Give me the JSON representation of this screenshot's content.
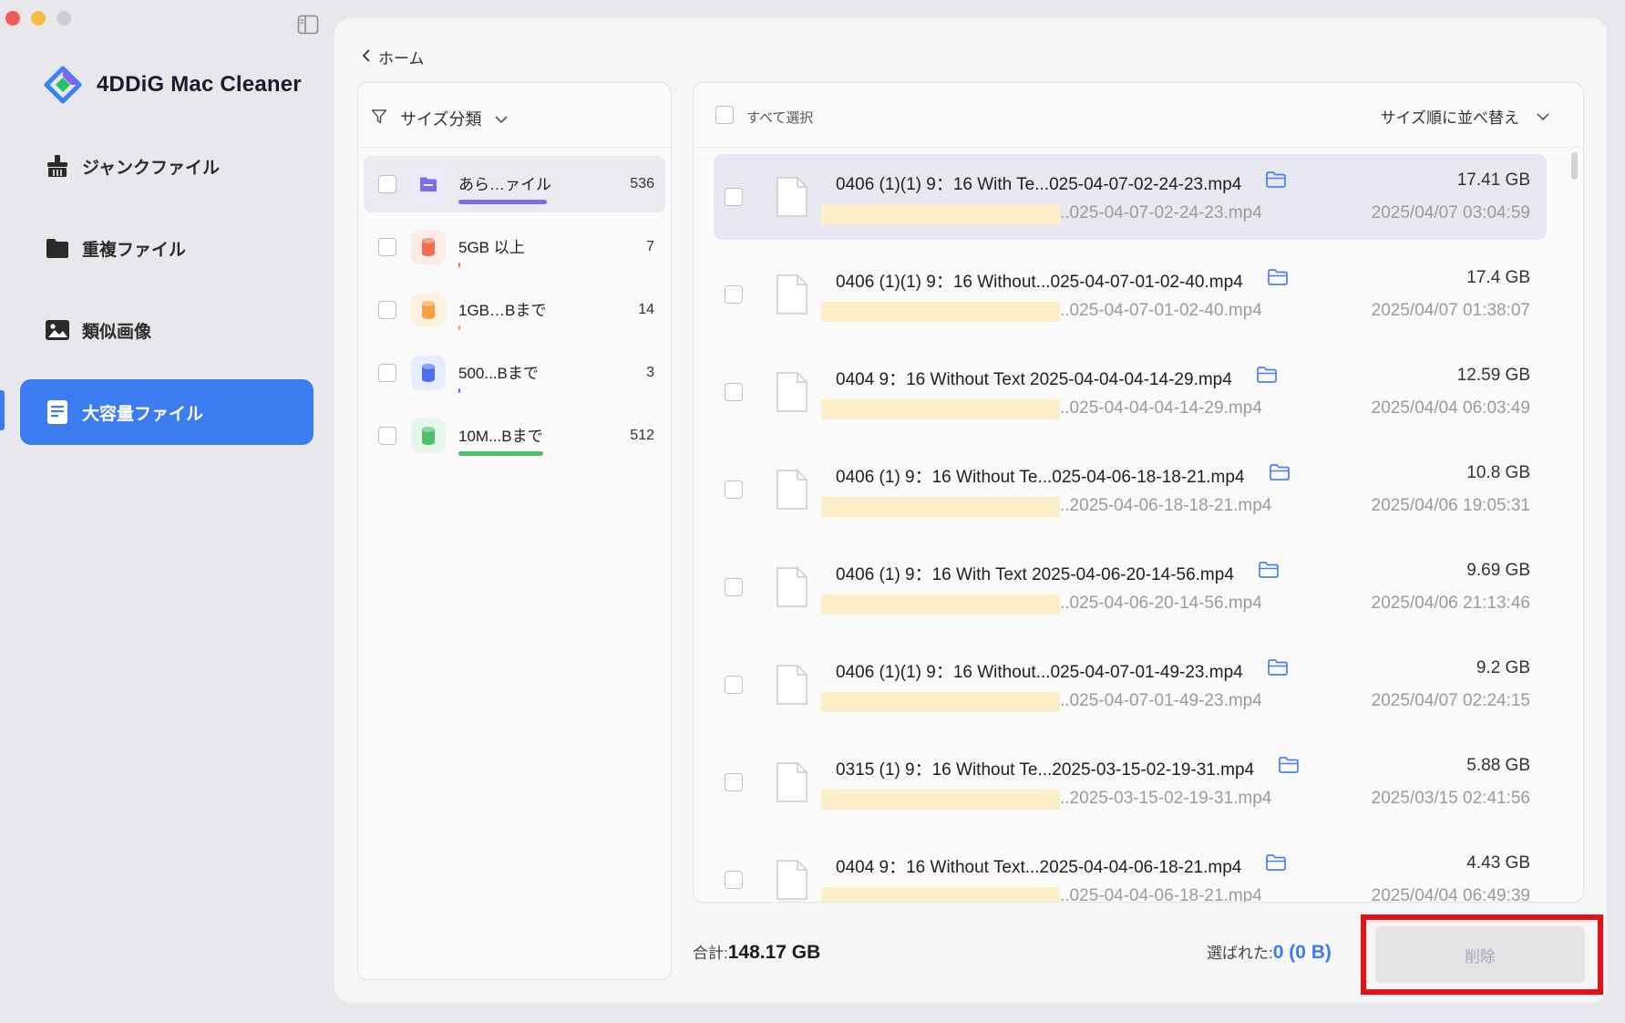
{
  "app": {
    "name": "4DDiG Mac Cleaner"
  },
  "sidebar": {
    "items": [
      {
        "label": "ジャンクファイル",
        "icon": "broom-icon"
      },
      {
        "label": "重複ファイル",
        "icon": "folder-icon"
      },
      {
        "label": "類似画像",
        "icon": "image-icon"
      },
      {
        "label": "大容量ファイル",
        "icon": "large-file-icon",
        "active": true
      }
    ]
  },
  "main": {
    "back_label": "ホーム",
    "category_panel": {
      "header": "サイズ分類",
      "categories": [
        {
          "label": "あら…ァイル",
          "count": "536",
          "color": "#7a6cf0",
          "bar_fraction": 0.97
        },
        {
          "label": "5GB 以上",
          "count": "7",
          "color": "#f06b4f",
          "bar_fraction": 0.01
        },
        {
          "label": "1GB…Bまで",
          "count": "14",
          "color": "#f5a33b",
          "bar_fraction": 0.02
        },
        {
          "label": "500...Bまで",
          "count": "3",
          "color": "#4b6ff0",
          "bar_fraction": 0.005
        },
        {
          "label": "10M...Bまで",
          "count": "512",
          "color": "#4fc06a",
          "bar_fraction": 0.93
        }
      ]
    },
    "file_panel": {
      "select_all_label": "すべて選択",
      "sort_label": "サイズ順に並べ替え",
      "files": [
        {
          "name": "0406 (1)(1) 9：16  With Te...025-04-07-02-24-23.mp4",
          "path": "..025-04-07-02-24-23.mp4",
          "size": "17.41  GB",
          "date": "2025/04/07 03:04:59",
          "selected": true
        },
        {
          "name": "0406 (1)(1) 9：16 Without...025-04-07-01-02-40.mp4",
          "path": "..025-04-07-01-02-40.mp4",
          "size": "17.4  GB",
          "date": "2025/04/07 01:38:07"
        },
        {
          "name": "0404 9：16 Without Text 2025-04-04-04-14-29.mp4",
          "path": "..025-04-04-04-14-29.mp4",
          "size": "12.59  GB",
          "date": "2025/04/04 06:03:49"
        },
        {
          "name": "0406 (1) 9：16 Without Te...025-04-06-18-18-21.mp4",
          "path": "..2025-04-06-18-18-21.mp4",
          "size": "10.8  GB",
          "date": "2025/04/06 19:05:31"
        },
        {
          "name": "0406 (1) 9：16  With Text 2025-04-06-20-14-56.mp4",
          "path": "..025-04-06-20-14-56.mp4",
          "size": "9.69  GB",
          "date": "2025/04/06 21:13:46"
        },
        {
          "name": "0406 (1)(1) 9：16 Without...025-04-07-01-49-23.mp4",
          "path": "..025-04-07-01-49-23.mp4",
          "size": "9.2  GB",
          "date": "2025/04/07 02:24:15"
        },
        {
          "name": "0315 (1) 9：16 Without Te...2025-03-15-02-19-31.mp4",
          "path": "..2025-03-15-02-19-31.mp4",
          "size": "5.88  GB",
          "date": "2025/03/15 02:41:56"
        },
        {
          "name": "0404 9：16 Without Text...2025-04-04-06-18-21.mp4",
          "path": "..025-04-04-06-18-21.mp4",
          "size": "4.43  GB",
          "date": "2025/04/04 06:49:39"
        }
      ]
    },
    "footer": {
      "total_label": "合計:",
      "total_value": "148.17 GB",
      "selected_label": "選ばれた:",
      "selected_value": "0 (0  B)",
      "delete_label": "削除"
    }
  },
  "colors": {
    "accent": "#3d7cf0",
    "highlight": "#ea0f14",
    "path_mask": "#fcefc8"
  }
}
